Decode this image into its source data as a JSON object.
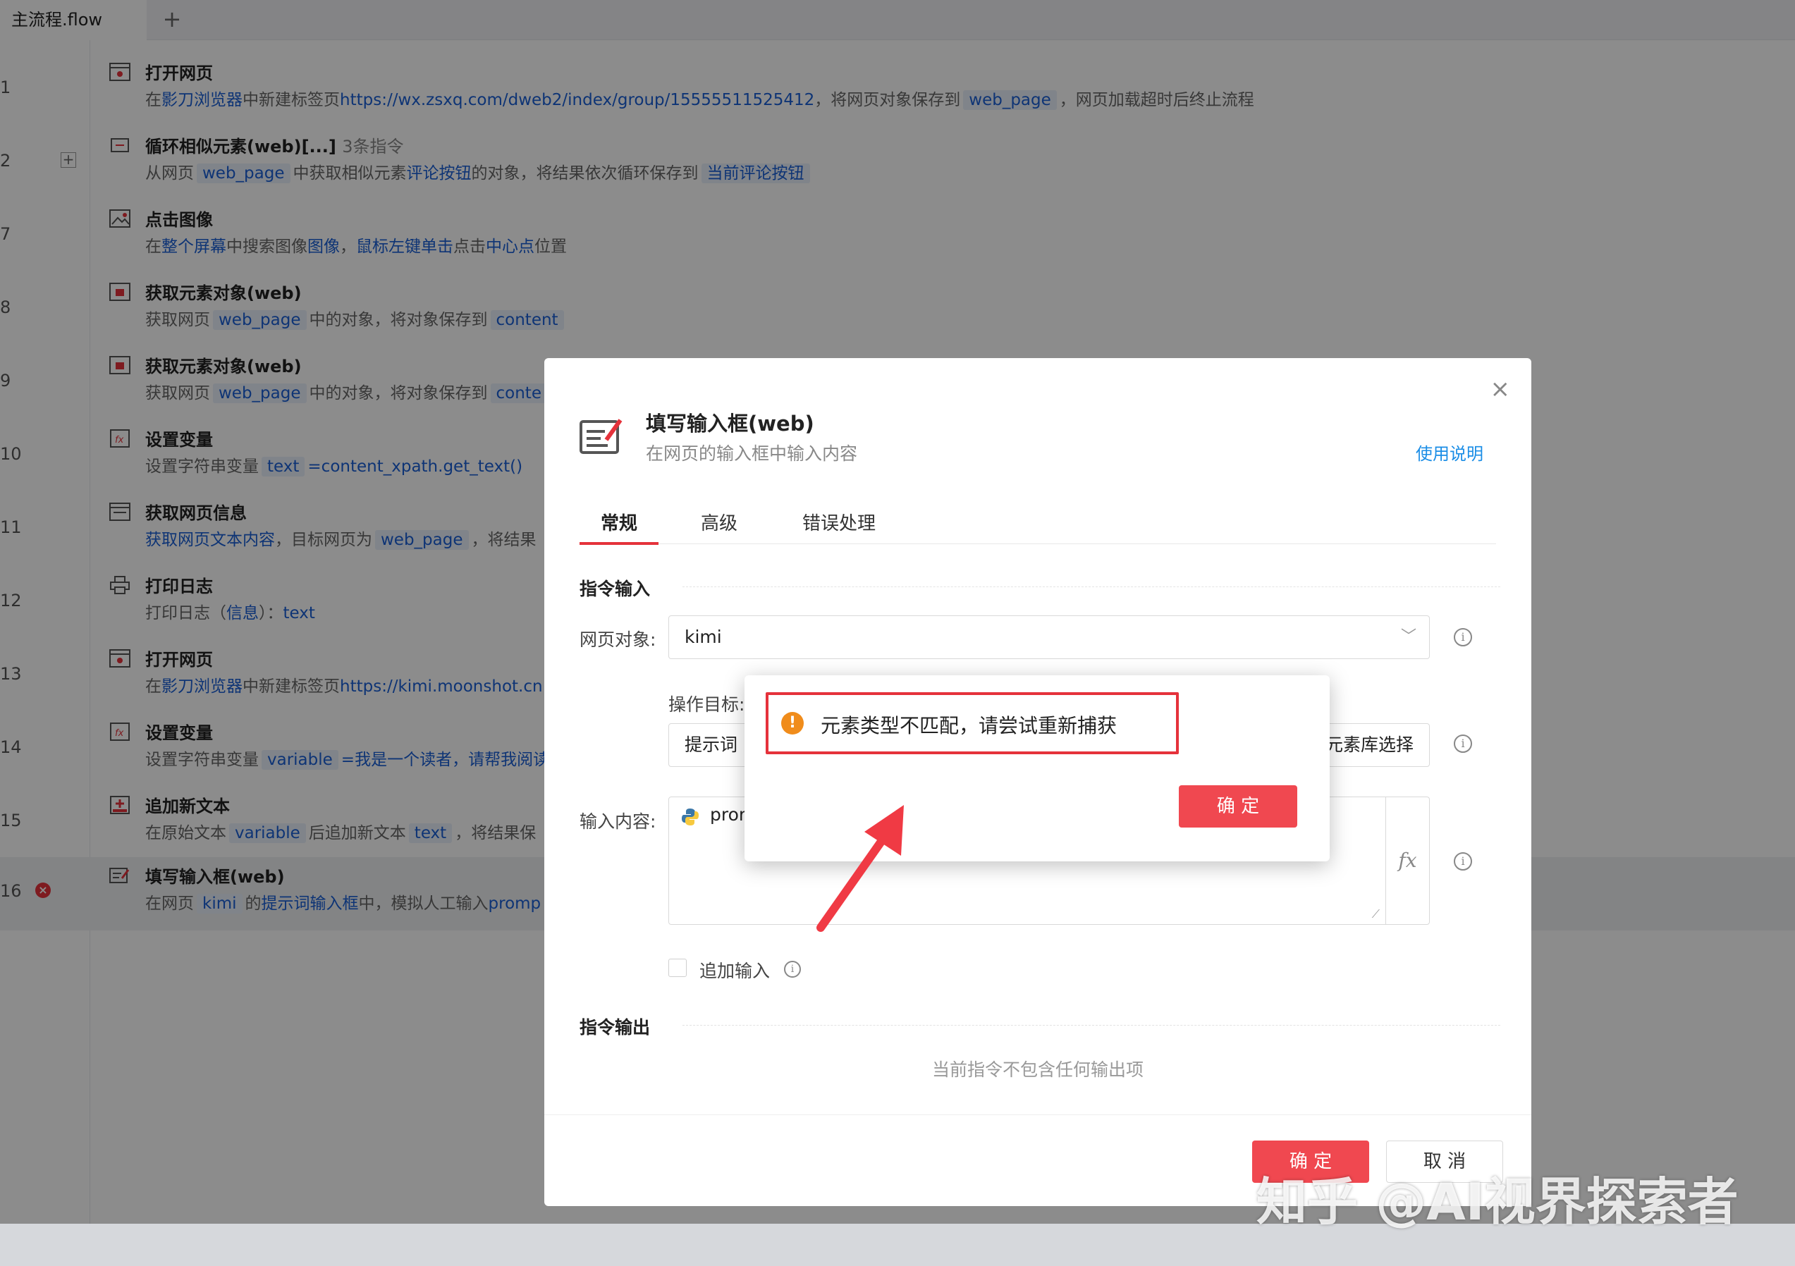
{
  "tabbar": {
    "tab_label": "主流程.flow",
    "add_label": "+"
  },
  "rows": [
    {
      "no": "1",
      "title": "打开网页",
      "d": [
        "在",
        "影刀浏览器",
        "中新建标签页",
        "https://wx.zsxq.com/dweb2/index/group/15555511525412",
        "，将网页对象保存到",
        "web_page",
        "，网页加载超时后终止流程"
      ]
    },
    {
      "no": "2",
      "title": "循环相似元素(web)[...]",
      "title_extra": "3条指令",
      "d": [
        "从网页",
        "web_page",
        "中获取相似元素",
        "评论按钮",
        "的对象，将结果依次循环保存到",
        "当前评论按钮"
      ]
    },
    {
      "no": "7",
      "title": "点击图像",
      "d": [
        "在",
        "整个屏幕",
        "中搜索图像",
        "图像",
        "，",
        "鼠标左键",
        "单击",
        "点击",
        "中心点",
        "位置"
      ]
    },
    {
      "no": "8",
      "title": "获取元素对象(web)",
      "d": [
        "获取网页",
        "web_page",
        "中的对象，将对象保存到",
        "content"
      ]
    },
    {
      "no": "9",
      "title": "获取元素对象(web)",
      "d": [
        "获取网页",
        "web_page",
        "中的对象，将对象保存到",
        "conte"
      ]
    },
    {
      "no": "10",
      "title": "设置变量",
      "d": [
        "设置字符串变量",
        "text",
        "=content_xpath.get_text()"
      ]
    },
    {
      "no": "11",
      "title": "获取网页信息",
      "d": [
        "获取网页文本内容",
        "，目标网页为",
        "web_page",
        "，将结果"
      ]
    },
    {
      "no": "12",
      "title": "打印日志",
      "d": [
        "打印日志（",
        "信息",
        "）：",
        "text"
      ]
    },
    {
      "no": "13",
      "title": "打开网页",
      "d": [
        "在",
        "影刀浏览器",
        "中新建标签页",
        "https://kimi.moonshot.cn"
      ]
    },
    {
      "no": "14",
      "title": "设置变量",
      "d": [
        "设置字符串变量",
        "variable",
        "=我是一个读者，请帮我阅读"
      ]
    },
    {
      "no": "15",
      "title": "追加新文本",
      "d": [
        "在原始文本",
        "variable",
        "后追加新文本",
        "text",
        "，将结果保"
      ]
    },
    {
      "no": "16",
      "title": "填写输入框(web)",
      "d": [
        "在网页",
        "kimi",
        "的",
        "提示词输入框",
        "中，模拟人工输入",
        "promp"
      ]
    }
  ],
  "dialog": {
    "close_label": "×",
    "title": "填写输入框(web)",
    "subtitle": "在网页的输入框中输入内容",
    "help_link": "使用说明",
    "tabs": [
      "常规",
      "高级",
      "错误处理"
    ],
    "section_input": "指令输入",
    "web_object_label": "网页对象:",
    "web_object_value": "kimi",
    "target_label": "操作目标:",
    "target_value": "提示词",
    "element_lib_label": "元素库选择",
    "input_label": "输入内容:",
    "input_value": "prom",
    "fx_label": "fx",
    "append_label": "追加输入",
    "section_output": "指令输出",
    "no_output": "当前指令不包含任何输出项",
    "ok_label": "确 定",
    "cancel_label": "取 消"
  },
  "popup": {
    "message": "元素类型不匹配，请尝试重新捕获",
    "ok_label": "确 定"
  },
  "watermark": "知乎 @AI视界探索者",
  "colors": {
    "accent_red": "#f04850",
    "link_blue": "#1a5fd6",
    "warning_orange": "#f08c1b"
  }
}
